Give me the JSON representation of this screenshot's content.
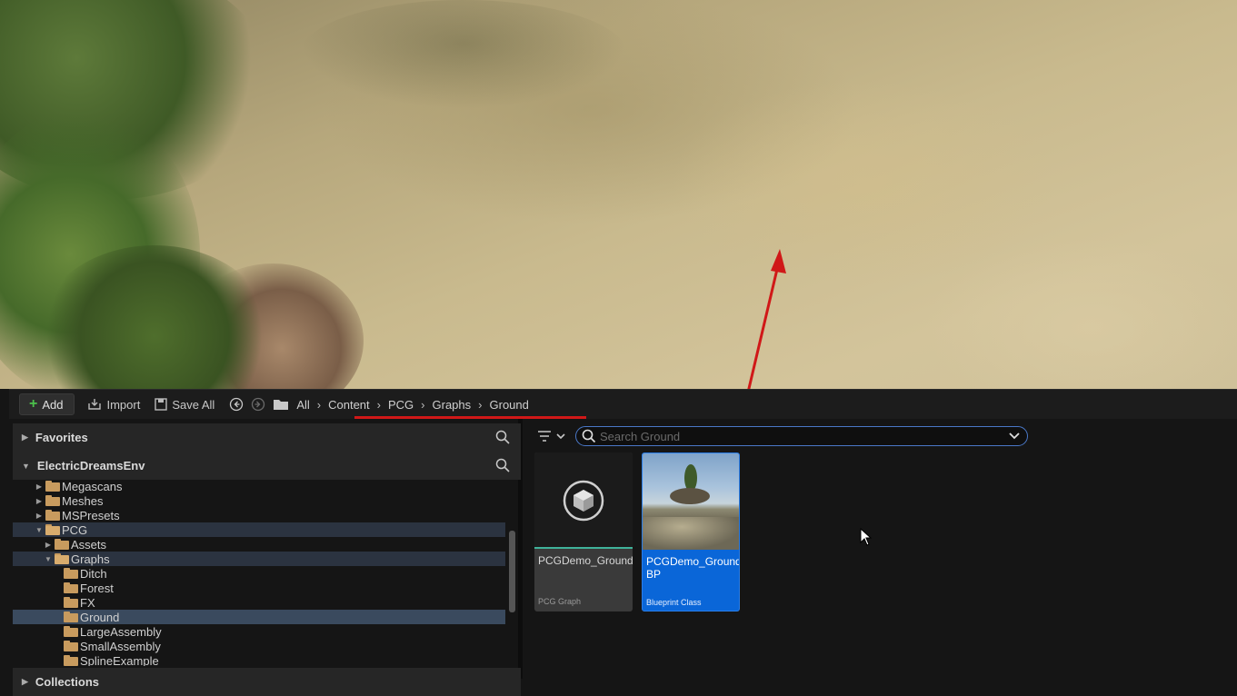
{
  "toolbar": {
    "add_label": "Add",
    "import_label": "Import",
    "save_all_label": "Save All",
    "breadcrumbs": [
      "All",
      "Content",
      "PCG",
      "Graphs",
      "Ground"
    ]
  },
  "sections": {
    "favorites": "Favorites",
    "project": "ElectricDreamsEnv",
    "collections": "Collections"
  },
  "tree": [
    "Megascans",
    "Meshes",
    "MSPresets",
    "PCG",
    "Assets",
    "Graphs",
    "Ditch",
    "Forest",
    "FX",
    "Ground",
    "LargeAssembly",
    "SmallAssembly",
    "SplineExample"
  ],
  "search": {
    "placeholder": "Search Ground"
  },
  "assets": [
    {
      "name": "PCGDemo_Ground",
      "type": "PCG Graph"
    },
    {
      "name": "PCGDemo_Ground BP",
      "type": "Blueprint Class"
    }
  ],
  "colors": {
    "accent": "#0a66d8",
    "annotation": "#d01818",
    "pcg_tile_underline": "#3fb29a"
  }
}
